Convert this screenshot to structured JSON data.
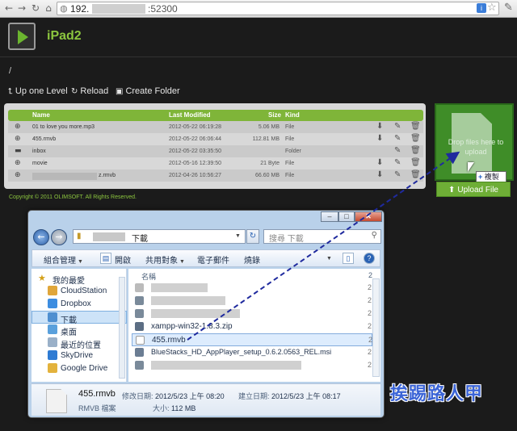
{
  "browser": {
    "url_prefix": "192.",
    "url_port": "52300"
  },
  "app": {
    "title": "iPad2",
    "path": "/",
    "copyright": "Copyright © 2011 OLIMSOFT. All Rights Reserved."
  },
  "toolbar": {
    "up_label": "Up one Level",
    "reload_label": "Reload",
    "create_folder_label": "Create Folder"
  },
  "table": {
    "headers": {
      "name": "Name",
      "modified": "Last Modified",
      "size": "Size",
      "kind": "Kind"
    },
    "rows": [
      {
        "name": "01 to love you more.mp3",
        "modified": "2012-05-22 06:19:28",
        "size": "5.06 MB",
        "kind": "File"
      },
      {
        "name": "455.rmvb",
        "modified": "2012-05-22 06:06:44",
        "size": "112.81 MB",
        "kind": "File"
      },
      {
        "name": "inbox",
        "modified": "2012-05-22 03:35:50",
        "size": "",
        "kind": "Folder"
      },
      {
        "name": "movie",
        "modified": "2012-05-16 12:39:50",
        "size": "21 Byte",
        "kind": "File"
      },
      {
        "name": "z.rmvb",
        "modified": "2012-04-26 10:56:27",
        "size": "66.60 MB",
        "kind": "File"
      }
    ]
  },
  "dropzone": {
    "text": "Drop files here to upload",
    "copy_badge": "複製",
    "upload_label": "Upload File"
  },
  "explorer": {
    "address_crumb": "下載",
    "search_placeholder": "搜尋 下載",
    "commands": {
      "organize": "組合管理",
      "open": "開啟",
      "share": "共用對象",
      "email": "電子郵件",
      "burn": "燒錄"
    },
    "nav_items": [
      "我的最愛",
      "CloudStation",
      "Dropbox",
      "下載",
      "桌面",
      "最近的位置",
      "SkyDrive",
      "Google Drive"
    ],
    "column_name": "名稱",
    "files": [
      {
        "name": "xampp-win32-1.8.3.zip"
      },
      {
        "name": "455.rmvb"
      },
      {
        "name": "BlueStacks_HD_AppPlayer_setup_0.6.2.0563_REL.msi"
      }
    ],
    "details": {
      "name": "455.rmvb",
      "type": "RMVB 檔案",
      "modified_label": "修改日期:",
      "modified_value": "2012/5/23 上午 08:20",
      "created_label": "建立日期:",
      "created_value": "2012/5/23 上午 08:17",
      "size_label": "大小:",
      "size_value": "112 MB"
    }
  },
  "watermark": "挨踢路人甲",
  "colors": {
    "accent_green": "#8cc63f",
    "drop_green": "#3f8d28",
    "arrow_blue": "#1f2a9e"
  }
}
